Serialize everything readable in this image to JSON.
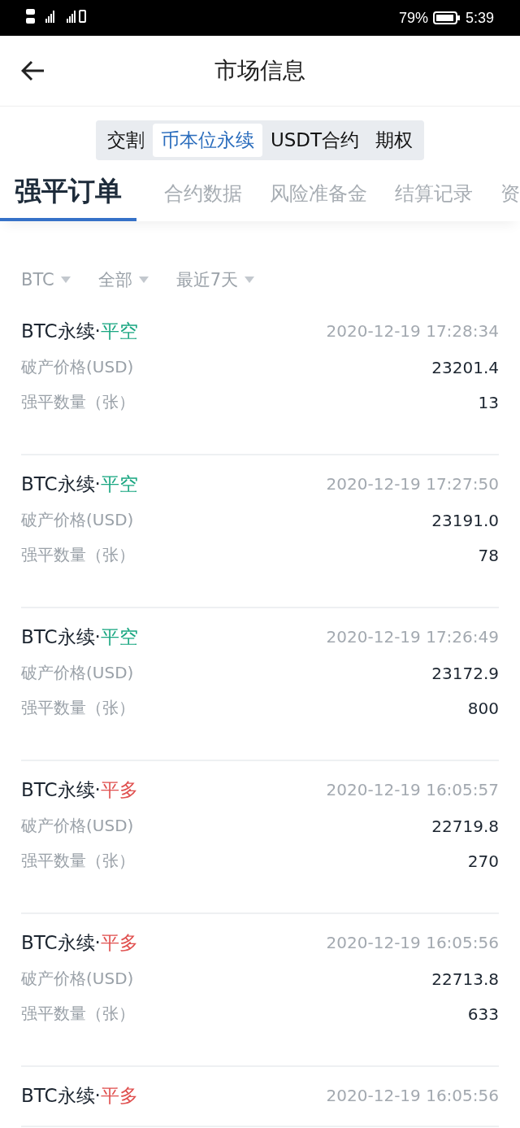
{
  "status_bar": {
    "battery_percent": "79%",
    "time": "5:39"
  },
  "header": {
    "title": "市场信息"
  },
  "segments": [
    {
      "label": "交割",
      "selected": false
    },
    {
      "label": "币本位永续",
      "selected": true
    },
    {
      "label": "USDT合约",
      "selected": false
    },
    {
      "label": "期权",
      "selected": false
    }
  ],
  "tabs": [
    {
      "label": "强平订单",
      "selected": true
    },
    {
      "label": "合约数据",
      "selected": false
    },
    {
      "label": "风险准备金",
      "selected": false
    },
    {
      "label": "结算记录",
      "selected": false
    },
    {
      "label": "资",
      "selected": false
    }
  ],
  "filters": [
    {
      "label": "BTC"
    },
    {
      "label": "全部"
    },
    {
      "label": "最近7天"
    }
  ],
  "orders": [
    {
      "title": "BTC永续·",
      "side": "平空",
      "kind": "short",
      "time": "2020-12-19 17:28:34",
      "rows": [
        {
          "label": "破产价格(USD)",
          "value": "23201.4"
        },
        {
          "label": "强平数量（张）",
          "value": "13"
        }
      ]
    },
    {
      "title": "BTC永续·",
      "side": "平空",
      "kind": "short",
      "time": "2020-12-19 17:27:50",
      "rows": [
        {
          "label": "破产价格(USD)",
          "value": "23191.0"
        },
        {
          "label": "强平数量（张）",
          "value": "78"
        }
      ]
    },
    {
      "title": "BTC永续·",
      "side": "平空",
      "kind": "short",
      "time": "2020-12-19 17:26:49",
      "rows": [
        {
          "label": "破产价格(USD)",
          "value": "23172.9"
        },
        {
          "label": "强平数量（张）",
          "value": "800"
        }
      ]
    },
    {
      "title": "BTC永续·",
      "side": "平多",
      "kind": "long",
      "time": "2020-12-19 16:05:57",
      "rows": [
        {
          "label": "破产价格(USD)",
          "value": "22719.8"
        },
        {
          "label": "强平数量（张）",
          "value": "270"
        }
      ]
    },
    {
      "title": "BTC永续·",
      "side": "平多",
      "kind": "long",
      "time": "2020-12-19 16:05:56",
      "rows": [
        {
          "label": "破产价格(USD)",
          "value": "22713.8"
        },
        {
          "label": "强平数量（张）",
          "value": "633"
        }
      ]
    },
    {
      "title": "BTC永续·",
      "side": "平多",
      "kind": "long",
      "time": "2020-12-19 16:05:56"
    }
  ]
}
